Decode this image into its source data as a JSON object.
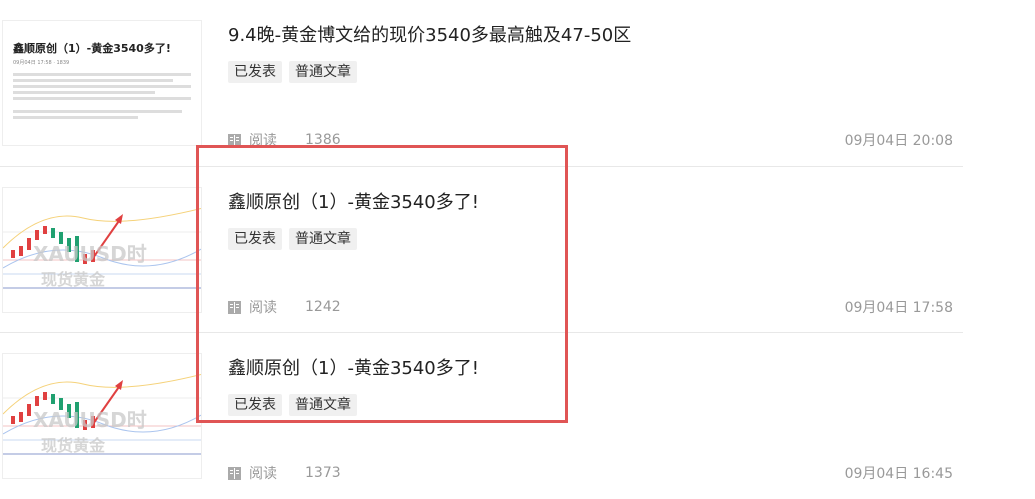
{
  "articles": [
    {
      "title": "9.4晚-黄金博文给的现价3540多最高触及47-50区",
      "tags": [
        "已发表",
        "普通文章"
      ],
      "read_label": "阅读",
      "read_count": "1386",
      "date": "09月04日 20:08",
      "thumb": {
        "type": "document",
        "heading": "鑫顺原创（1）-黄金3540多了!",
        "meta": "09月04日 17:58 · 1839"
      }
    },
    {
      "title": "鑫顺原创（1）-黄金3540多了!",
      "tags": [
        "已发表",
        "普通文章"
      ],
      "read_label": "阅读",
      "read_count": "1242",
      "date": "09月04日 17:58",
      "thumb": {
        "type": "chart",
        "wm1": "XAUUSD时",
        "wm2": "现货黄金"
      }
    },
    {
      "title": "鑫顺原创（1）-黄金3540多了!",
      "tags": [
        "已发表",
        "普通文章"
      ],
      "read_label": "阅读",
      "read_count": "1373",
      "date": "09月04日 16:45",
      "thumb": {
        "type": "chart",
        "wm1": "XAUUSD时",
        "wm2": "现货黄金"
      }
    }
  ],
  "colors": {
    "highlight": "#e05555",
    "up": "#e04040",
    "down": "#20a070",
    "arrow": "#e04040"
  },
  "icons": {
    "read": "book-icon"
  }
}
